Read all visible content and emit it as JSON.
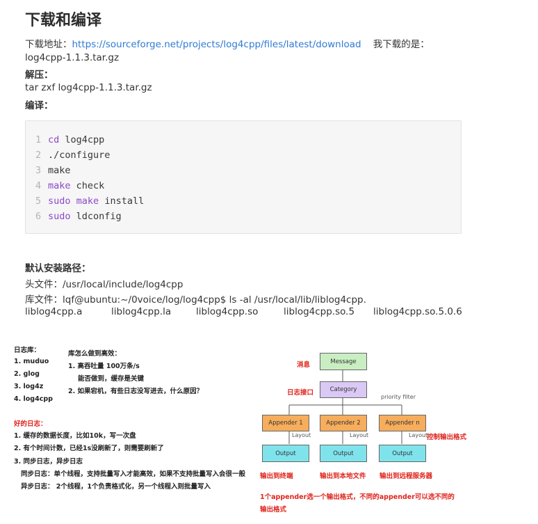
{
  "heading": "下载和编译",
  "download": {
    "label": "下载地址：",
    "url": "https://sourceforge.net/projects/log4cpp/files/latest/download",
    "suffix": "我下载的是：",
    "file": "log4cpp-1.1.3.tar.gz"
  },
  "extract": {
    "label": "解压：",
    "command": "tar zxf log4cpp-1.1.3.tar.gz"
  },
  "compile_label": "编译：",
  "code": {
    "line_numbers": [
      "1",
      "2",
      "3",
      "4",
      "5",
      "6"
    ],
    "l1_kw": "cd",
    "l1_rest": "log4cpp",
    "l2": "./configure",
    "l3_kw": "make",
    "l4_kw": "make",
    "l4_rest": "check",
    "l5_kw1": "sudo",
    "l5_kw2": "make",
    "l5_rest": "install",
    "l6_kw": "sudo",
    "l6_rest": "ldconfig"
  },
  "install": {
    "title": "默认安装路径：",
    "header_line": "头文件：/usr/local/include/log4cpp",
    "lib_line": "库文件：lqf@ubuntu:~/0voice/log/log4cpp$ ls -al /usr/local/lib/liblog4cpp.",
    "files": [
      "liblog4cpp.a",
      "liblog4cpp.la",
      "liblog4cpp.so",
      "liblog4cpp.so.5",
      "liblog4cpp.so.5.0.6"
    ]
  },
  "notes": {
    "libs_title": "日志库：",
    "libs": [
      "1. muduo",
      "2. glog",
      "3. log4z",
      "4. log4cpp"
    ],
    "perf_title": "库怎么做到高效：",
    "perf_1": "1. 高吞吐量 100万条/s",
    "perf_1b": "能否做到，缓存是关键",
    "perf_2": "2. 如果宕机，有些日志没写进去，什么原因？",
    "good_title": "好的日志：",
    "good": [
      "1. 缓存的数据长度，比如10k，写一次盘",
      "2. 有个时间计数，已经1s没刷新了，则需要刷新了",
      "3. 同步日志，异步日志"
    ],
    "sync": "同步日志：单个线程，支持批量写入才能高效，如果不支持批量写入会很一般",
    "async": "异步日志：  2个线程，1个负责格式化，另一个线程入则批量写入"
  },
  "diagram": {
    "label_message": "消息",
    "label_category": "日志接口",
    "label_format": "控制输出格式",
    "message": "Message",
    "category": "Category",
    "priority_filter": "priority filter",
    "appender1": "Appender 1",
    "appender2": "Appender 2",
    "appendern": "Appender n",
    "layout": "Layout",
    "output": "Output",
    "out_terminal": "输出到终端",
    "out_file": "输出到本地文件",
    "out_remote": "输出到远程服务器",
    "footnote_1": "1个appender选一个输出格式，不同的appender可以选不同的",
    "footnote_2": "输出格式"
  }
}
